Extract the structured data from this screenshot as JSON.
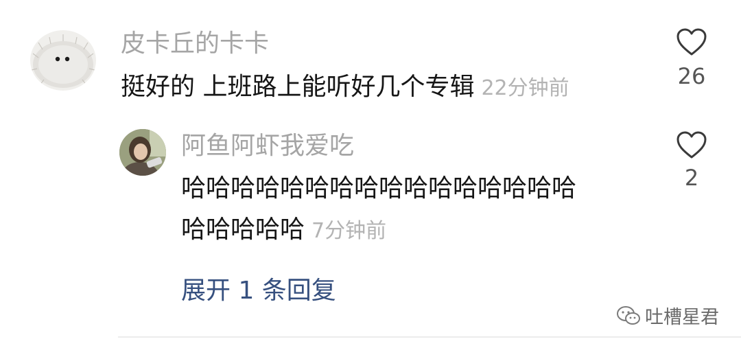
{
  "comment": {
    "username": "皮卡丘的卡卡",
    "text": "挺好的 上班路上能听好几个专辑",
    "time": "22分钟前",
    "likes": "26",
    "avatar_icon": "hedgehog-avatar",
    "like_icon": "heart-outline-icon"
  },
  "reply": {
    "username": "阿鱼阿虾我爱吃",
    "text_line1": "哈哈哈哈哈哈哈哈哈哈哈哈哈哈哈哈",
    "text_line2": "哈哈哈哈哈",
    "time": "7分钟前",
    "likes": "2",
    "avatar_icon": "user-photo-avatar",
    "like_icon": "heart-outline-icon"
  },
  "expand_label": "展开 1 条回复",
  "watermark": {
    "text": "吐槽星君",
    "icon": "wechat-icon"
  },
  "colors": {
    "name": "#a5a5a5",
    "body": "#161616",
    "time": "#b3b3b3",
    "link": "#36507f"
  }
}
